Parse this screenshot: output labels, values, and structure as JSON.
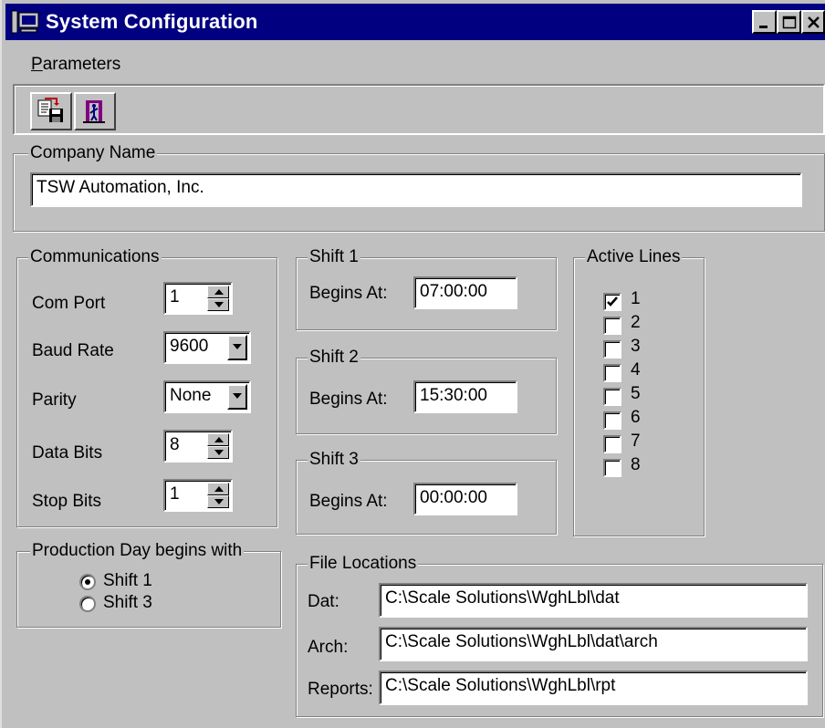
{
  "window": {
    "title": "System Configuration"
  },
  "menu": {
    "parameters_underline": "P",
    "parameters_rest": "arameters"
  },
  "toolbar": {
    "buttons": [
      {
        "icon": "save-document-icon"
      },
      {
        "icon": "exit-door-icon"
      }
    ]
  },
  "company": {
    "legend": "Company Name",
    "value": "TSW Automation, Inc."
  },
  "communications": {
    "legend": "Communications",
    "com_port": {
      "label": "Com Port",
      "value": "1"
    },
    "baud_rate": {
      "label": "Baud Rate",
      "value": "9600"
    },
    "parity": {
      "label": "Parity",
      "value": "None"
    },
    "data_bits": {
      "label": "Data Bits",
      "value": "8"
    },
    "stop_bits": {
      "label": "Stop Bits",
      "value": "1"
    }
  },
  "shifts": [
    {
      "legend": "Shift 1",
      "label": "Begins At:",
      "value": "07:00:00"
    },
    {
      "legend": "Shift 2",
      "label": "Begins At:",
      "value": "15:30:00"
    },
    {
      "legend": "Shift 3",
      "label": "Begins At:",
      "value": "00:00:00"
    }
  ],
  "active_lines": {
    "legend": "Active Lines",
    "lines": [
      {
        "label": "1",
        "checked": true
      },
      {
        "label": "2",
        "checked": false
      },
      {
        "label": "3",
        "checked": false
      },
      {
        "label": "4",
        "checked": false
      },
      {
        "label": "5",
        "checked": false
      },
      {
        "label": "6",
        "checked": false
      },
      {
        "label": "7",
        "checked": false
      },
      {
        "label": "8",
        "checked": false
      }
    ]
  },
  "production_day": {
    "legend": "Production Day begins with",
    "options": [
      {
        "label": "Shift 1",
        "selected": true
      },
      {
        "label": "Shift 3",
        "selected": false
      }
    ]
  },
  "file_locations": {
    "legend": "File Locations",
    "dat": {
      "label": "Dat:",
      "value": "C:\\Scale Solutions\\WghLbl\\dat"
    },
    "arch": {
      "label": "Arch:",
      "value": "C:\\Scale Solutions\\WghLbl\\dat\\arch"
    },
    "reports": {
      "label": "Reports:",
      "value": "C:\\Scale Solutions\\WghLbl\\rpt"
    }
  },
  "colors": {
    "titlebar": "#000080",
    "face": "#c0c0c0"
  }
}
